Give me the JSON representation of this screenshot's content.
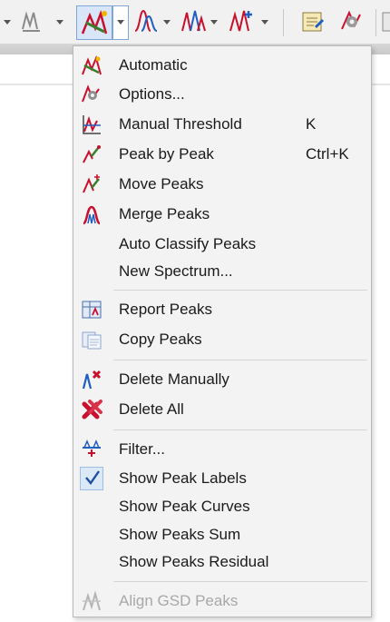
{
  "toolbar": {
    "buttons": [
      {
        "icon": "peak-detect-icon"
      },
      {
        "icon": "automatic-peak-icon"
      },
      {
        "icon": "peak-curve-icon"
      },
      {
        "icon": "peak-split-icon"
      },
      {
        "icon": "peak-add-icon"
      },
      {
        "icon": "report-icon"
      },
      {
        "icon": "options-icon"
      }
    ]
  },
  "menu": {
    "items": [
      {
        "label": "Automatic",
        "shortcut": "",
        "icon": "automatic-peak-icon"
      },
      {
        "label": "Options...",
        "shortcut": "",
        "icon": "options-icon"
      },
      {
        "label": "Manual Threshold",
        "shortcut": "K",
        "icon": "manual-threshold-icon"
      },
      {
        "label": "Peak by Peak",
        "shortcut": "Ctrl+K",
        "icon": "peak-by-peak-icon"
      },
      {
        "label": "Move Peaks",
        "shortcut": "",
        "icon": "move-peaks-icon"
      },
      {
        "label": "Merge Peaks",
        "shortcut": "",
        "icon": "merge-peaks-icon"
      },
      {
        "label": "Auto Classify Peaks",
        "shortcut": "",
        "icon": ""
      },
      {
        "label": "New Spectrum...",
        "shortcut": "",
        "icon": ""
      },
      {
        "label": "Report Peaks",
        "shortcut": "",
        "icon": "report-peaks-icon"
      },
      {
        "label": "Copy Peaks",
        "shortcut": "",
        "icon": "copy-peaks-icon"
      },
      {
        "label": "Delete Manually",
        "shortcut": "",
        "icon": "delete-manually-icon"
      },
      {
        "label": "Delete All",
        "shortcut": "",
        "icon": "delete-all-icon"
      },
      {
        "label": "Filter...",
        "shortcut": "",
        "icon": "filter-icon"
      },
      {
        "label": "Show Peak Labels",
        "shortcut": "",
        "icon": "checkmark-icon",
        "checked": true
      },
      {
        "label": "Show Peak Curves",
        "shortcut": "",
        "icon": ""
      },
      {
        "label": "Show Peaks Sum",
        "shortcut": "",
        "icon": ""
      },
      {
        "label": "Show Peaks Residual",
        "shortcut": "",
        "icon": ""
      },
      {
        "label": "Align GSD Peaks",
        "shortcut": "",
        "icon": "align-gsd-icon",
        "disabled": true
      }
    ]
  },
  "colors": {
    "menu_bg": "#f3f3f3",
    "accent_red": "#c8102e",
    "accent_blue": "#1f5fbf",
    "disabled_text": "#a8a8a8"
  }
}
